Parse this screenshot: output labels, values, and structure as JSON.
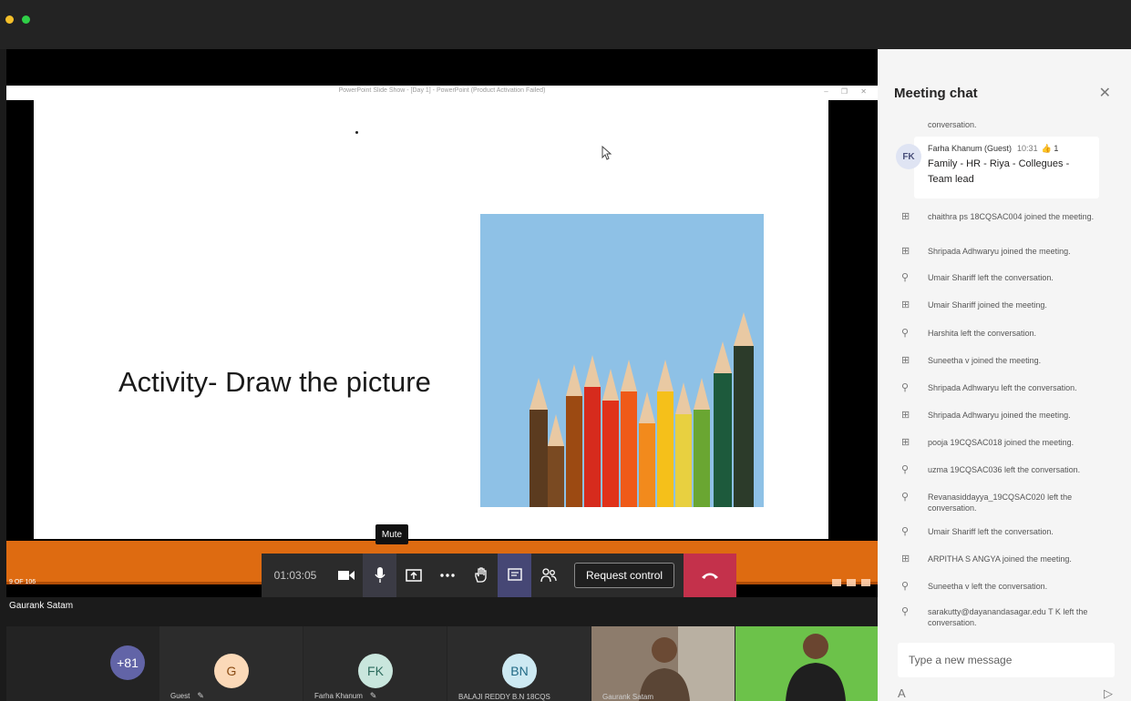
{
  "presentation": {
    "window_title": "PowerPoint Slide Show - [Day 1] - PowerPoint (Product Activation Failed)",
    "window_controls": "–  ❐  ✕",
    "slide_title": "Activity- Draw the picture",
    "slide_counter": "9 OF 106",
    "presenter_name": "Gaurank Satam",
    "theme_colors": {
      "orange": "#de6b11",
      "background": "#000000"
    }
  },
  "controls": {
    "timer": "01:03:05",
    "mute_tooltip": "Mute",
    "request_control_label": "Request control",
    "icons": [
      "camera-icon",
      "microphone-icon",
      "share-screen-icon",
      "more-icon",
      "raise-hand-icon",
      "chat-icon",
      "participants-icon",
      "hang-up-icon"
    ]
  },
  "participants": [
    {
      "initials": "+81",
      "label": "",
      "color": "#6264a7",
      "text_color": "#ffffff"
    },
    {
      "initials": "G",
      "label": "Guest",
      "color": "#fbd9b8",
      "text_color": "#8a4a12"
    },
    {
      "initials": "FK",
      "label": "Farha Khanum",
      "color": "#c9e6dd",
      "text_color": "#2c6b5d"
    },
    {
      "initials": "BN",
      "label": "BALAJI REDDY B.N 18CQS",
      "color": "#cde9f2",
      "text_color": "#226a86"
    },
    {
      "initials": "",
      "label": "Gaurank Satam",
      "color": "#7a6a5c",
      "text_color": "#ffffff"
    },
    {
      "initials": "",
      "label": "",
      "color": "#6cc24a",
      "text_color": "#ffffff"
    }
  ],
  "chat": {
    "title": "Meeting chat",
    "close_icon": "✕",
    "continuation": "conversation.",
    "message": {
      "avatar": "FK",
      "author": "Farha Khanum (Guest)",
      "time": "10:31",
      "likes": "1",
      "body": "Family - HR - Riya - Collegues - Team lead"
    },
    "events": [
      {
        "type": "joined",
        "text": "chaithra ps 18CQSAC004 joined the meeting."
      },
      {
        "type": "joined",
        "text": "Shripada Adhwaryu joined the meeting."
      },
      {
        "type": "left",
        "text": "Umair Shariff left the conversation."
      },
      {
        "type": "joined",
        "text": "Umair Shariff joined the meeting."
      },
      {
        "type": "left",
        "text": "Harshita left the conversation."
      },
      {
        "type": "joined",
        "text": "Suneetha v joined the meeting."
      },
      {
        "type": "left",
        "text": "Shripada Adhwaryu left the conversation."
      },
      {
        "type": "joined",
        "text": "Shripada Adhwaryu joined the meeting."
      },
      {
        "type": "joined",
        "text": "pooja 19CQSAC018 joined the meeting."
      },
      {
        "type": "left",
        "text": "uzma 19CQSAC036 left the conversation."
      },
      {
        "type": "left",
        "text": "Revanasiddayya_19CQSAC020 left the conversation."
      },
      {
        "type": "left",
        "text": "Umair Shariff left the conversation."
      },
      {
        "type": "joined",
        "text": "ARPITHA S ANGYA joined the meeting."
      },
      {
        "type": "left",
        "text": "Suneetha v left the conversation."
      },
      {
        "type": "left",
        "text": "sarakutty@dayanandasagar.edu T K left the conversation."
      }
    ],
    "compose_placeholder": "Type a new message",
    "format_icon": "A",
    "send_icon": "▷"
  }
}
